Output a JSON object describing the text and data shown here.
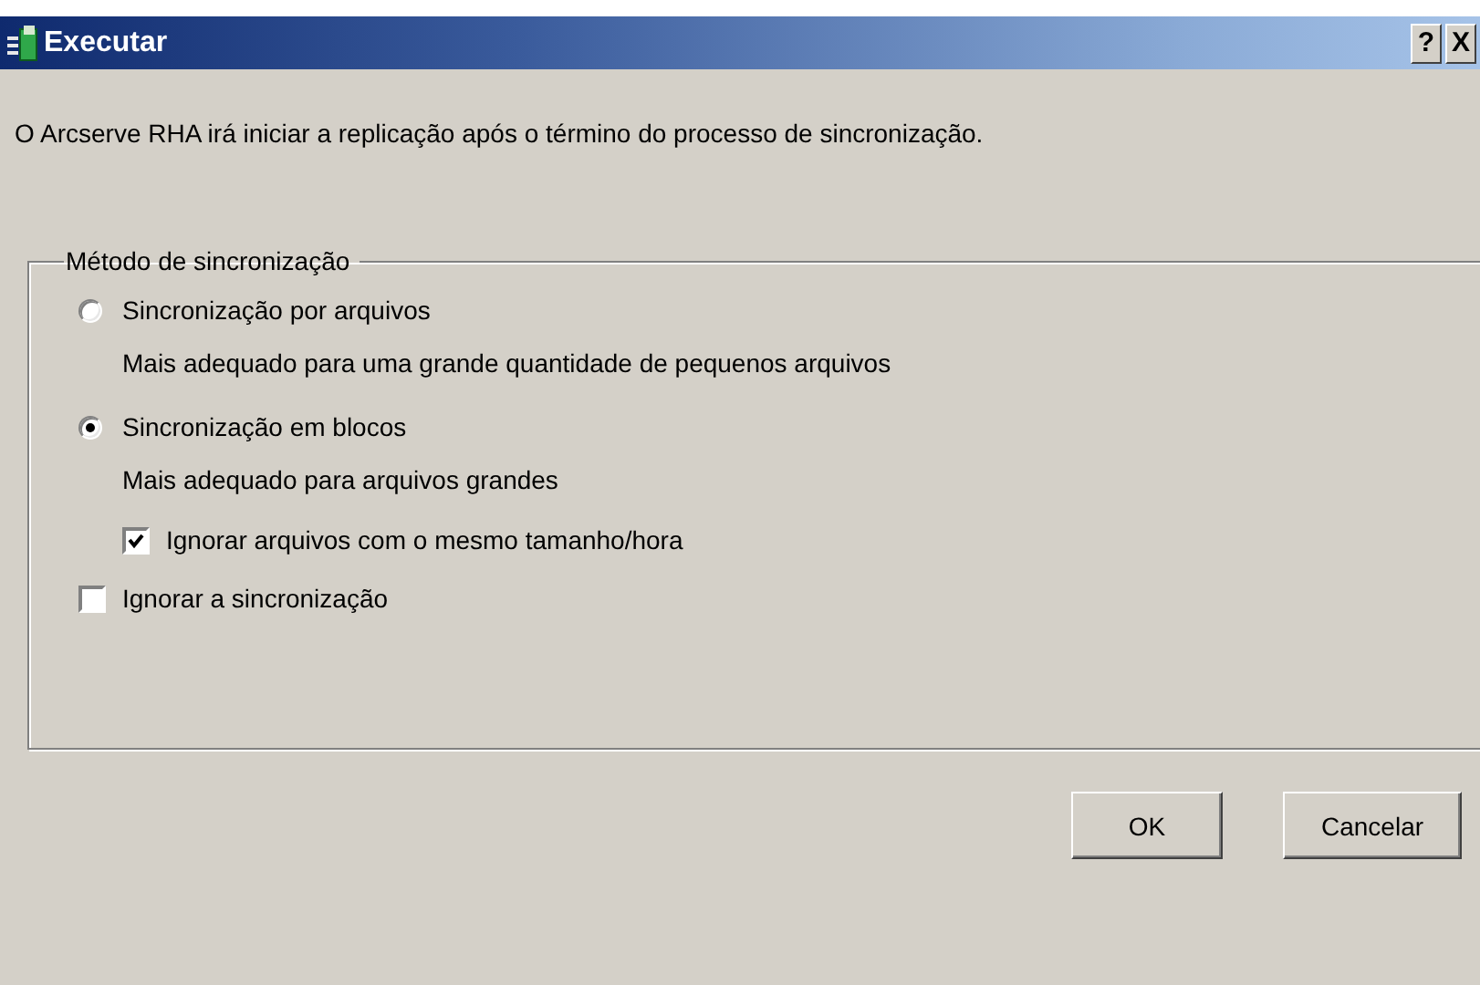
{
  "window": {
    "title": "Executar",
    "help_button": "?",
    "close_button": "X"
  },
  "message": "O Arcserve RHA irá iniciar a replicação após o término do processo de sincronização.",
  "group": {
    "title": "Método de sincronização",
    "options": [
      {
        "kind": "radio",
        "label": "Sincronização por arquivos",
        "selected": false,
        "description": "Mais adequado para uma grande quantidade de pequenos arquivos"
      },
      {
        "kind": "radio",
        "label": "Sincronização em blocos",
        "selected": true,
        "description": "Mais adequado para arquivos grandes",
        "children": [
          {
            "kind": "checkbox",
            "label": "Ignorar arquivos com o mesmo tamanho/hora",
            "checked": true
          }
        ]
      },
      {
        "kind": "checkbox",
        "label": "Ignorar a sincronização",
        "checked": false
      }
    ]
  },
  "buttons": [
    {
      "label": "OK"
    },
    {
      "label": "Cancelar"
    }
  ]
}
